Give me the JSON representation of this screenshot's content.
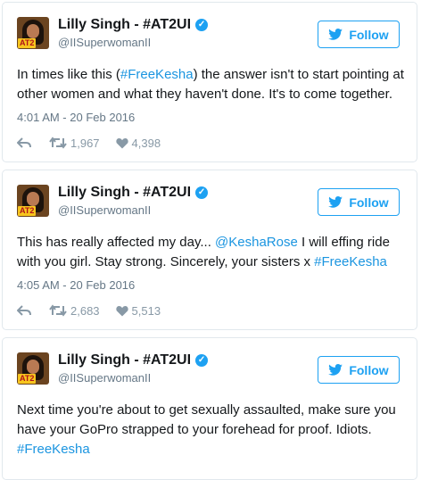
{
  "tweets": [
    {
      "name": "Lilly Singh - #AT2UI",
      "handle": "@IISuperwomanII",
      "follow_label": "Follow",
      "text_parts": [
        "In times like this (",
        "#FreeKesha",
        ") the answer isn't to start pointing at other women and what they haven't done. It's to come together."
      ],
      "timestamp": "4:01 AM - 20 Feb 2016",
      "retweets": "1,967",
      "likes": "4,398"
    },
    {
      "name": "Lilly Singh - #AT2UI",
      "handle": "@IISuperwomanII",
      "follow_label": "Follow",
      "text_parts": [
        "This has really affected my day... ",
        "@KeshaRose",
        " I will effing ride with you girl. Stay strong. Sincerely, your sisters x ",
        "#FreeKesha"
      ],
      "timestamp": "4:05 AM - 20 Feb 2016",
      "retweets": "2,683",
      "likes": "5,513"
    },
    {
      "name": "Lilly Singh - #AT2UI",
      "handle": "@IISuperwomanII",
      "follow_label": "Follow",
      "text_parts": [
        "Next time you're about to get sexually assaulted, make sure you have your GoPro strapped to your forehead for proof. Idiots. ",
        "#FreeKesha"
      ]
    }
  ],
  "avatar_tag": "AT2",
  "icons": [
    "reply-icon",
    "retweet-icon",
    "heart-icon",
    "twitter-bird-icon",
    "verified-badge-icon"
  ],
  "colors": {
    "accent": "#1da1f2",
    "link": "#1b95e0",
    "muted": "#657786",
    "border": "#e1e8ed"
  }
}
